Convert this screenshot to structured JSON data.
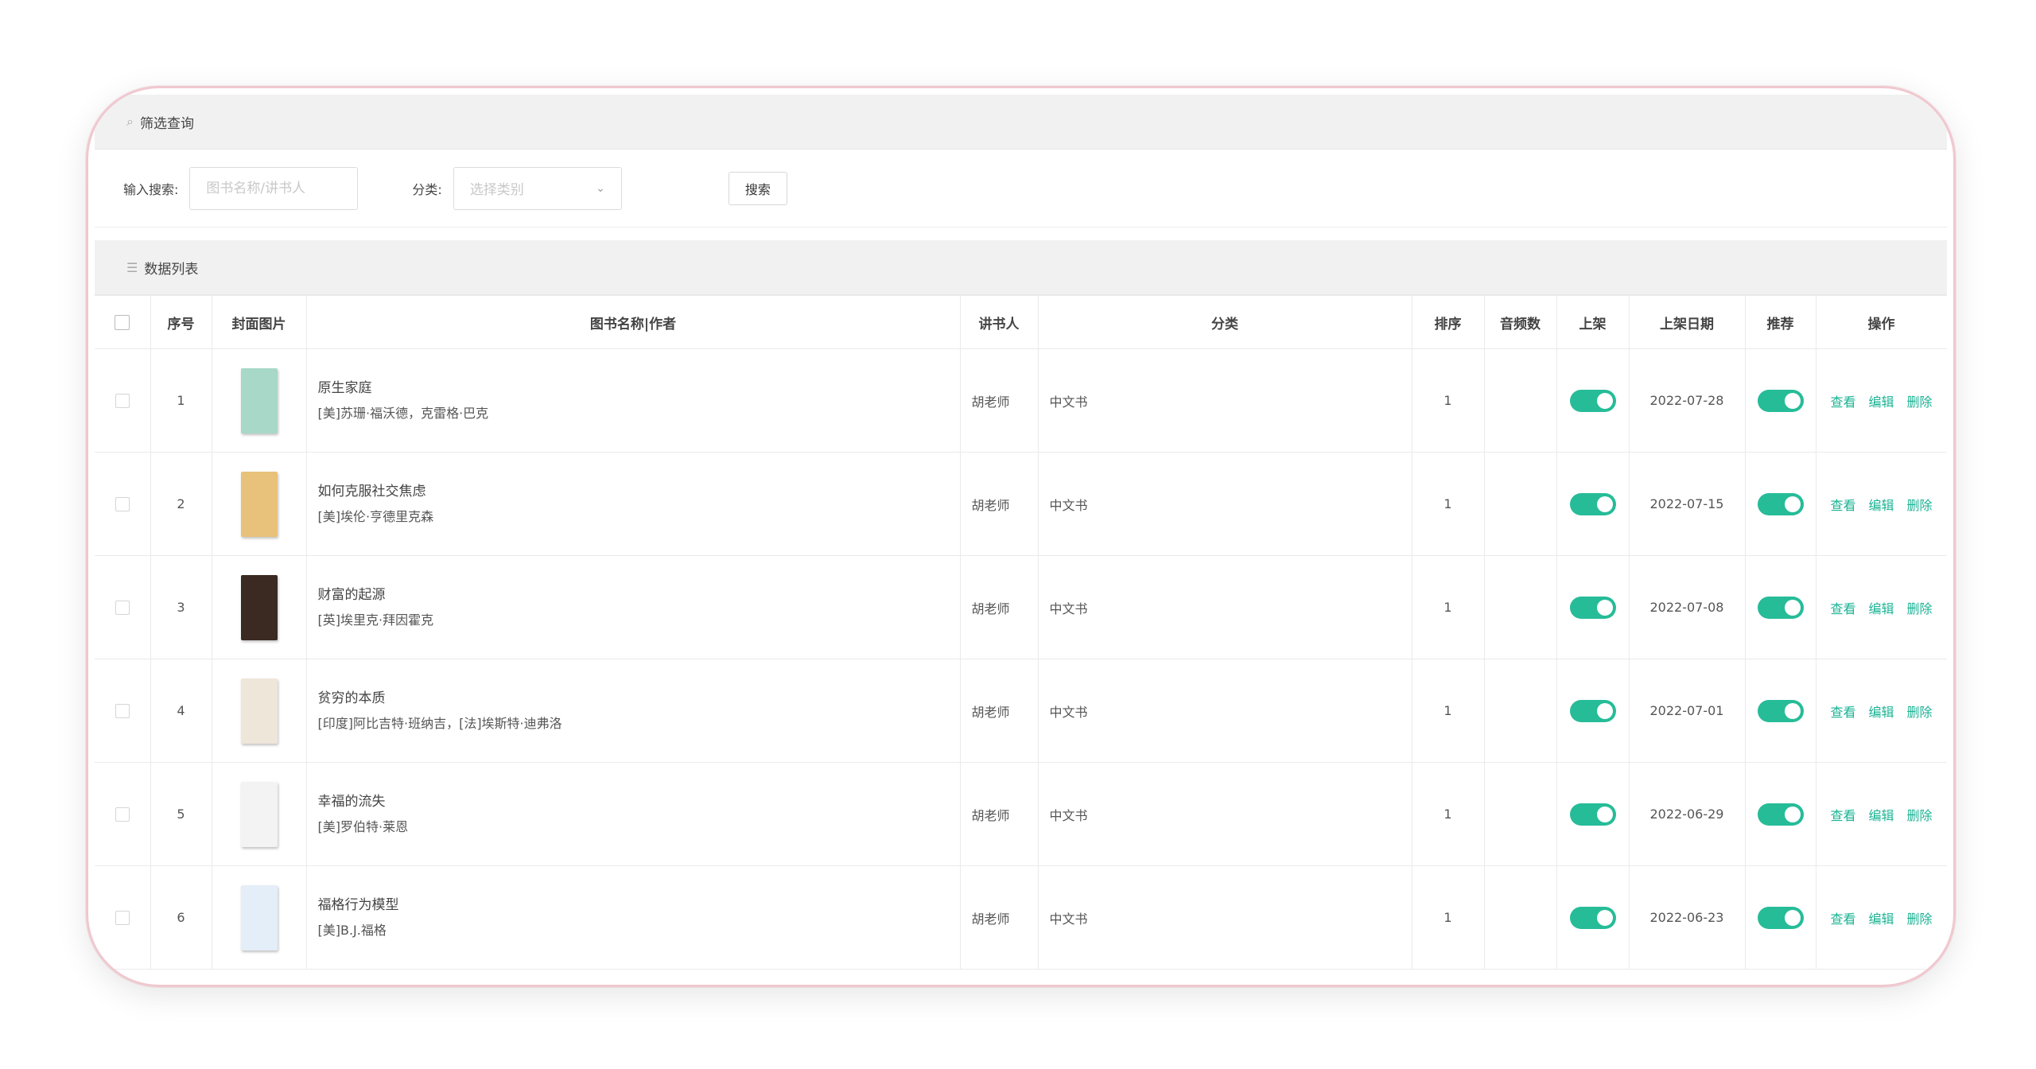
{
  "filter_section": {
    "title": "筛选查询",
    "icon": "search-icon"
  },
  "filter": {
    "search_label": "输入搜索:",
    "search_placeholder": "图书名称/讲书人",
    "category_label": "分类:",
    "category_placeholder": "选择类别",
    "search_button": "搜索"
  },
  "list_section": {
    "title": "数据列表",
    "icon": "list-icon"
  },
  "table": {
    "headers": {
      "index": "序号",
      "cover": "封面图片",
      "name": "图书名称|作者",
      "speaker": "讲书人",
      "category": "分类",
      "sort": "排序",
      "audio_count": "音频数",
      "on_shelf": "上架",
      "shelf_date": "上架日期",
      "recommend": "推荐",
      "actions": "操作"
    },
    "action_labels": {
      "view": "查看",
      "edit": "编辑",
      "delete": "删除"
    },
    "rows": [
      {
        "index": "1",
        "title": "原生家庭",
        "author": "[美]苏珊·福沃德，克雷格·巴克",
        "speaker": "胡老师",
        "category": "中文书",
        "sort": "1",
        "audio_count": "",
        "on_shelf": true,
        "date": "2022-07-28",
        "recommend": true,
        "cover_color": "#a8d8c8"
      },
      {
        "index": "2",
        "title": "如何克服社交焦虑",
        "author": "[美]埃伦·亨德里克森",
        "speaker": "胡老师",
        "category": "中文书",
        "sort": "1",
        "audio_count": "",
        "on_shelf": true,
        "date": "2022-07-15",
        "recommend": true,
        "cover_color": "#e8c27a"
      },
      {
        "index": "3",
        "title": "财富的起源",
        "author": "[英]埃里克·拜因霍克",
        "speaker": "胡老师",
        "category": "中文书",
        "sort": "1",
        "audio_count": "",
        "on_shelf": true,
        "date": "2022-07-08",
        "recommend": true,
        "cover_color": "#3a2a22"
      },
      {
        "index": "4",
        "title": "贫穷的本质",
        "author": "[印度]阿比吉特·班纳吉，[法]埃斯特·迪弗洛",
        "speaker": "胡老师",
        "category": "中文书",
        "sort": "1",
        "audio_count": "",
        "on_shelf": true,
        "date": "2022-07-01",
        "recommend": true,
        "cover_color": "#efe6da"
      },
      {
        "index": "5",
        "title": "幸福的流失",
        "author": "[美]罗伯特·莱恩",
        "speaker": "胡老师",
        "category": "中文书",
        "sort": "1",
        "audio_count": "",
        "on_shelf": true,
        "date": "2022-06-29",
        "recommend": true,
        "cover_color": "#f3f3f3"
      },
      {
        "index": "6",
        "title": "福格行为模型",
        "author": "[美]B.J.福格",
        "speaker": "胡老师",
        "category": "中文书",
        "sort": "1",
        "audio_count": "",
        "on_shelf": true,
        "date": "2022-06-23",
        "recommend": true,
        "cover_color": "#e4eef8"
      }
    ]
  },
  "colors": {
    "accent": "#26bc98",
    "link": "#1cb394",
    "frame_border": "#f0c8cf",
    "header_bg": "#f1f1f1"
  }
}
